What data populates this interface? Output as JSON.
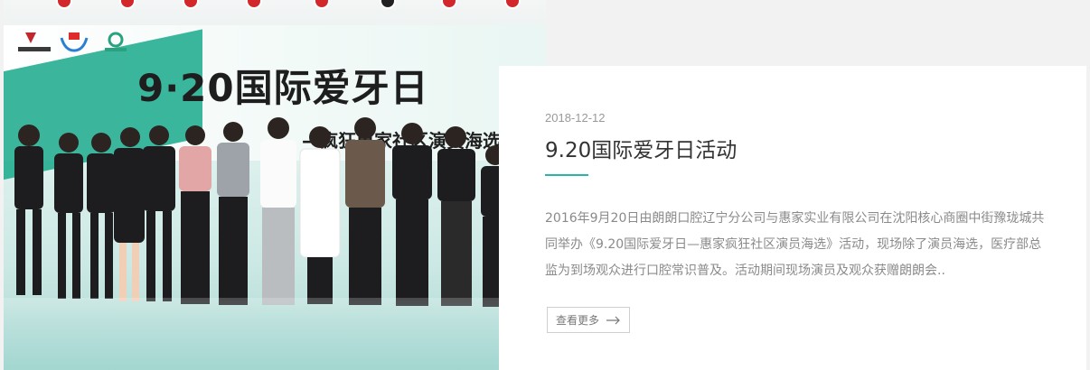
{
  "photo": {
    "banner_headline": "9·20国际爱牙日",
    "banner_subline": "—疯狂惠家社区演员海选",
    "accent": "#19a98b"
  },
  "article": {
    "date": "2018-12-12",
    "title": "9.20国际爱牙日活动",
    "description": "2016年9月20日由朗朗口腔辽宁分公司与惠家实业有限公司在沈阳核心商圈中街豫珑城共同举办《9.20国际爱牙日—惠家疯狂社区演员海选》活动，现场除了演员海选，医疗部总监为到场观众进行口腔常识普及。活动期间现场演员及观众获赠朗朗会..",
    "more_label": "查看更多",
    "more_icon": "arrow-right-icon",
    "accent_color": "#2bb5a6"
  }
}
